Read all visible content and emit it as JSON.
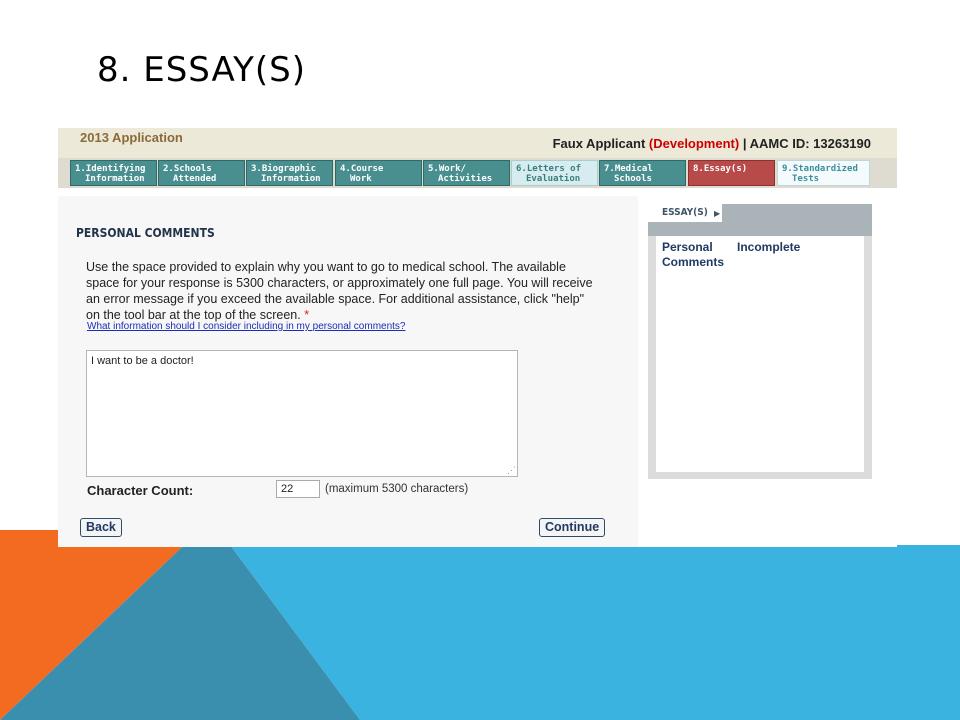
{
  "slide": {
    "title": "8. ESSAY(S)"
  },
  "header": {
    "app_year": "2013 Application",
    "applicant_name": "Faux Applicant",
    "applicant_env": "(Development)",
    "separator": "|",
    "aamc_id": "AAMC ID: 13263190"
  },
  "tabs": [
    {
      "line1": "1.Identifying",
      "line2": "Information"
    },
    {
      "line1": "2.Schools",
      "line2": "Attended"
    },
    {
      "line1": "3.Biographic",
      "line2": "Information"
    },
    {
      "line1": "4.Course",
      "line2": "Work"
    },
    {
      "line1": "5.Work/",
      "line2": "Activities"
    },
    {
      "line1": "6.Letters of",
      "line2": "Evaluation"
    },
    {
      "line1": "7.Medical",
      "line2": "Schools"
    },
    {
      "line1": "8.Essay(s)",
      "line2": ""
    },
    {
      "line1": "9.Standardized",
      "line2": "Tests"
    }
  ],
  "main": {
    "section_title": "PERSONAL COMMENTS",
    "instructions": "Use the space provided to explain why you want to go to medical school. The available space for your response is 5300 characters, or approximately one full page. You will receive an error message if you exceed the available space. For additional assistance, click \"help\" on the tool bar at the top of the screen.",
    "required_mark": "*",
    "help_link": "What information should I consider including in my personal comments?",
    "essay_text": "I want to be a doctor!",
    "char_count_label": "Character Count:",
    "char_count_value": "22",
    "char_count_max": "(maximum 5300 characters)",
    "back_label": "Back",
    "continue_label": "Continue"
  },
  "sidebar": {
    "tab_label": "ESSAY(S)",
    "item_name": "Personal Comments",
    "item_status": "Incomplete"
  },
  "colors": {
    "orange": "#f26b21",
    "blue": "#3bb3e0",
    "dark_blue": "#3a8fae",
    "tab_teal": "#4a8f8f",
    "tab_active": "#b84a4a"
  }
}
